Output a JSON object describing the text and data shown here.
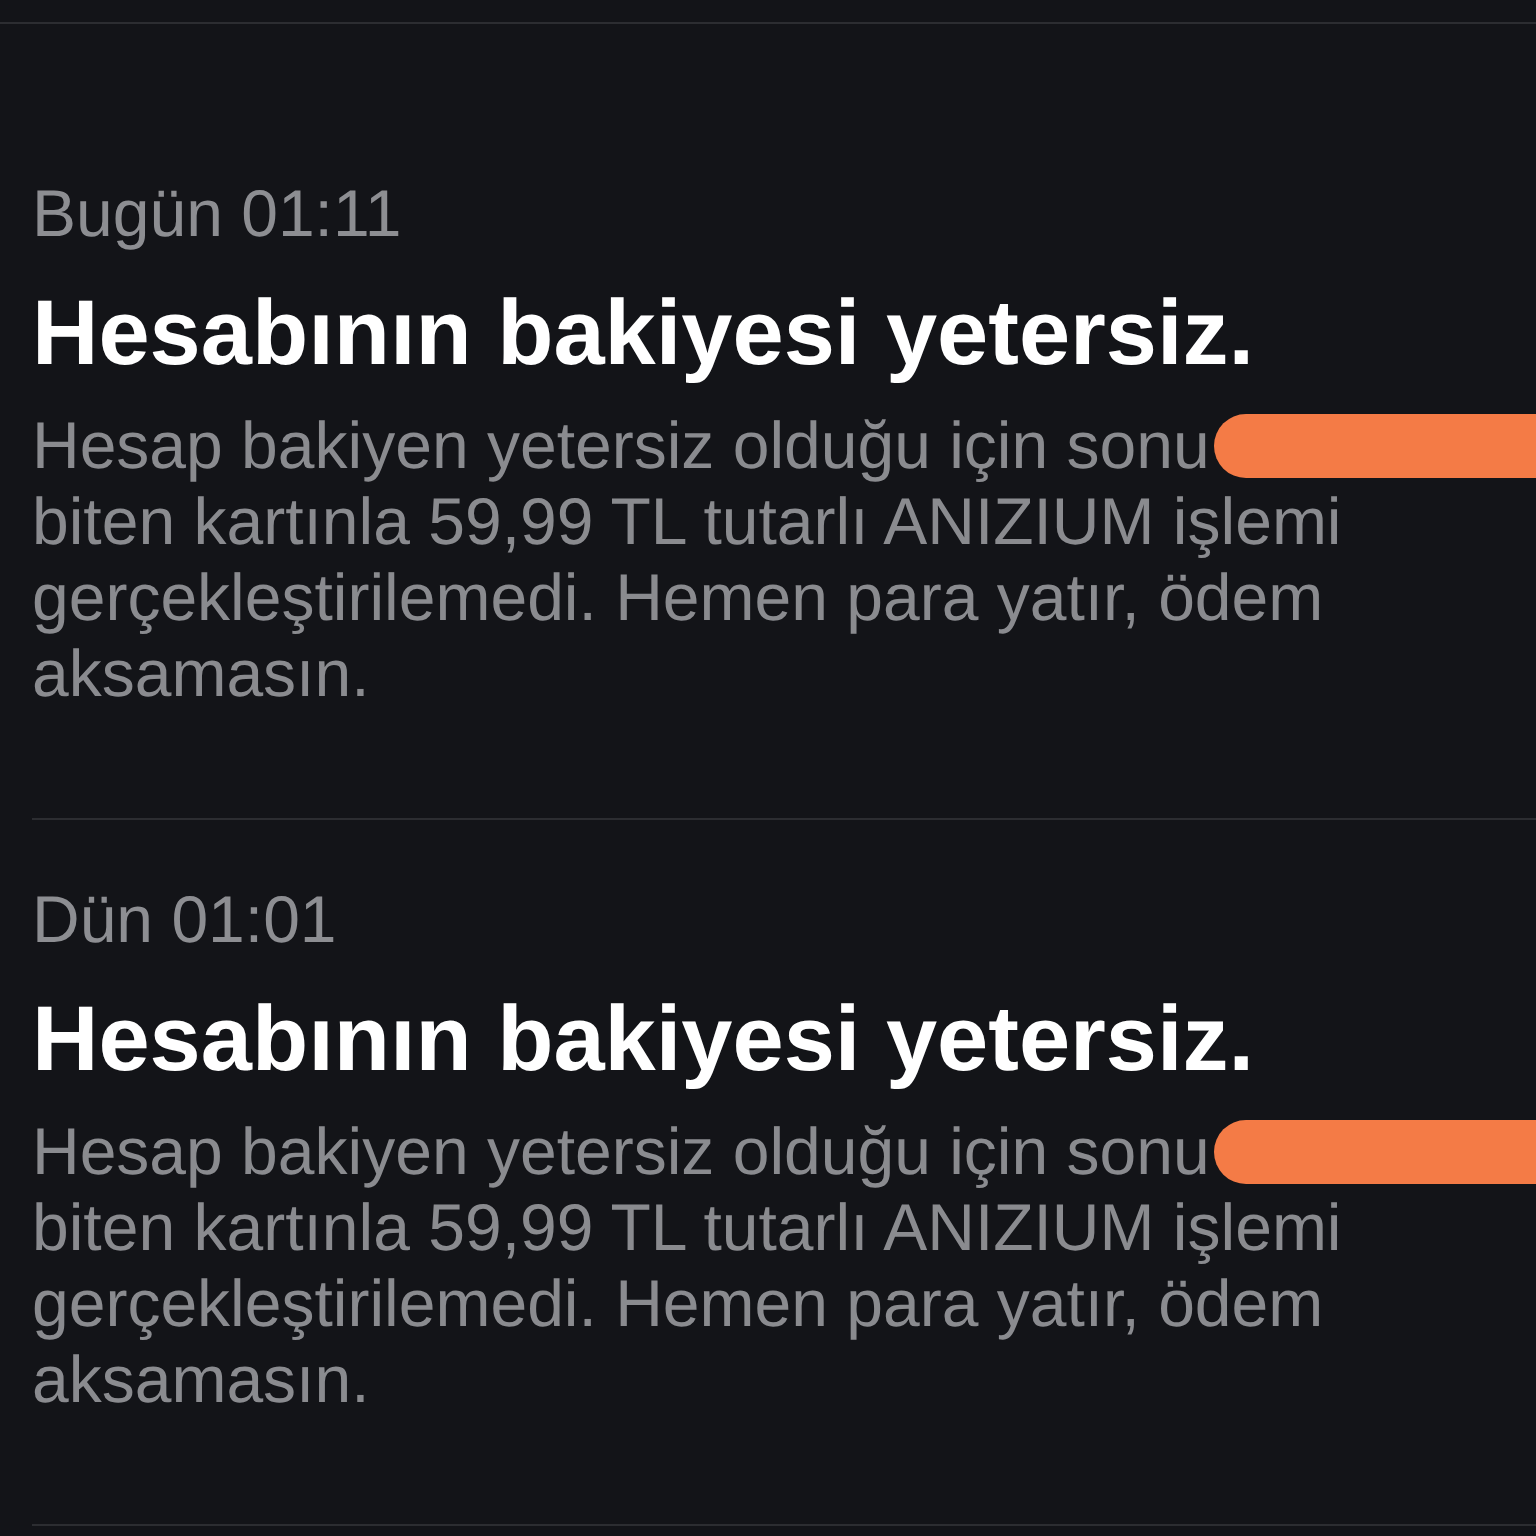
{
  "notifications": [
    {
      "time": "Bugün 01:11",
      "title": "Hesabının bakiyesi yetersiz.",
      "body_lines": [
        "Hesap bakiyen yetersiz olduğu için sonu",
        "biten kartınla 59,99 TL tutarlı ANIZIUM işlemi",
        "gerçekleştirilemedi. Hemen para yatır, ödem",
        "aksamasın."
      ],
      "redacted": true
    },
    {
      "time": "Dün 01:01",
      "title": "Hesabının bakiyesi yetersiz.",
      "body_lines": [
        "Hesap bakiyen yetersiz olduğu için sonu",
        "biten kartınla 59,99 TL tutarlı ANIZIUM işlemi",
        "gerçekleştirilemedi. Hemen para yatır, ödem",
        "aksamasın."
      ],
      "redacted": true
    }
  ]
}
